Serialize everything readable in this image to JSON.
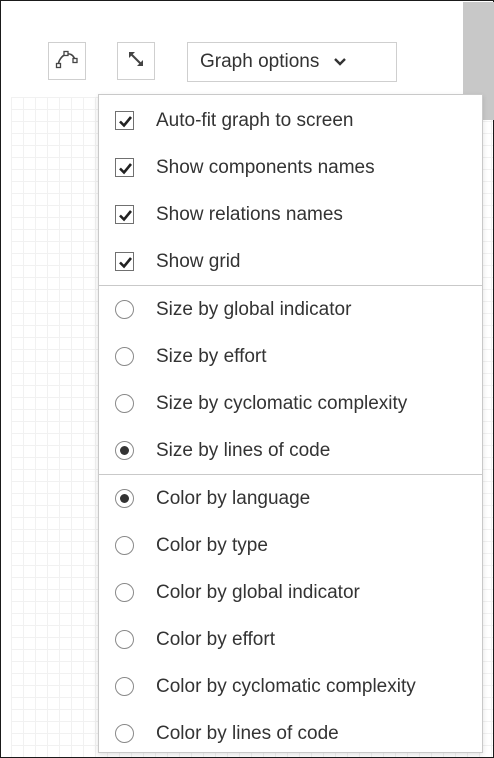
{
  "toolbar": {
    "layout_icon": "curve-path-icon",
    "expand_icon": "expand-diagonal-icon",
    "graph_options_label": "Graph options",
    "graph_options_icon": "chevron-down-icon"
  },
  "menu": {
    "display_options": [
      {
        "label": "Auto-fit graph to screen",
        "checked": true
      },
      {
        "label": "Show components names",
        "checked": true
      },
      {
        "label": "Show relations names",
        "checked": true
      },
      {
        "label": "Show grid",
        "checked": true
      }
    ],
    "size_options": [
      {
        "label": "Size by global indicator",
        "selected": false
      },
      {
        "label": "Size by effort",
        "selected": false
      },
      {
        "label": "Size by cyclomatic complexity",
        "selected": false
      },
      {
        "label": "Size by lines of code",
        "selected": true
      }
    ],
    "color_options": [
      {
        "label": "Color by language",
        "selected": true
      },
      {
        "label": "Color by type",
        "selected": false
      },
      {
        "label": "Color by global indicator",
        "selected": false
      },
      {
        "label": "Color by effort",
        "selected": false
      },
      {
        "label": "Color by cyclomatic complexity",
        "selected": false
      },
      {
        "label": "Color by lines of code",
        "selected": false
      }
    ]
  }
}
